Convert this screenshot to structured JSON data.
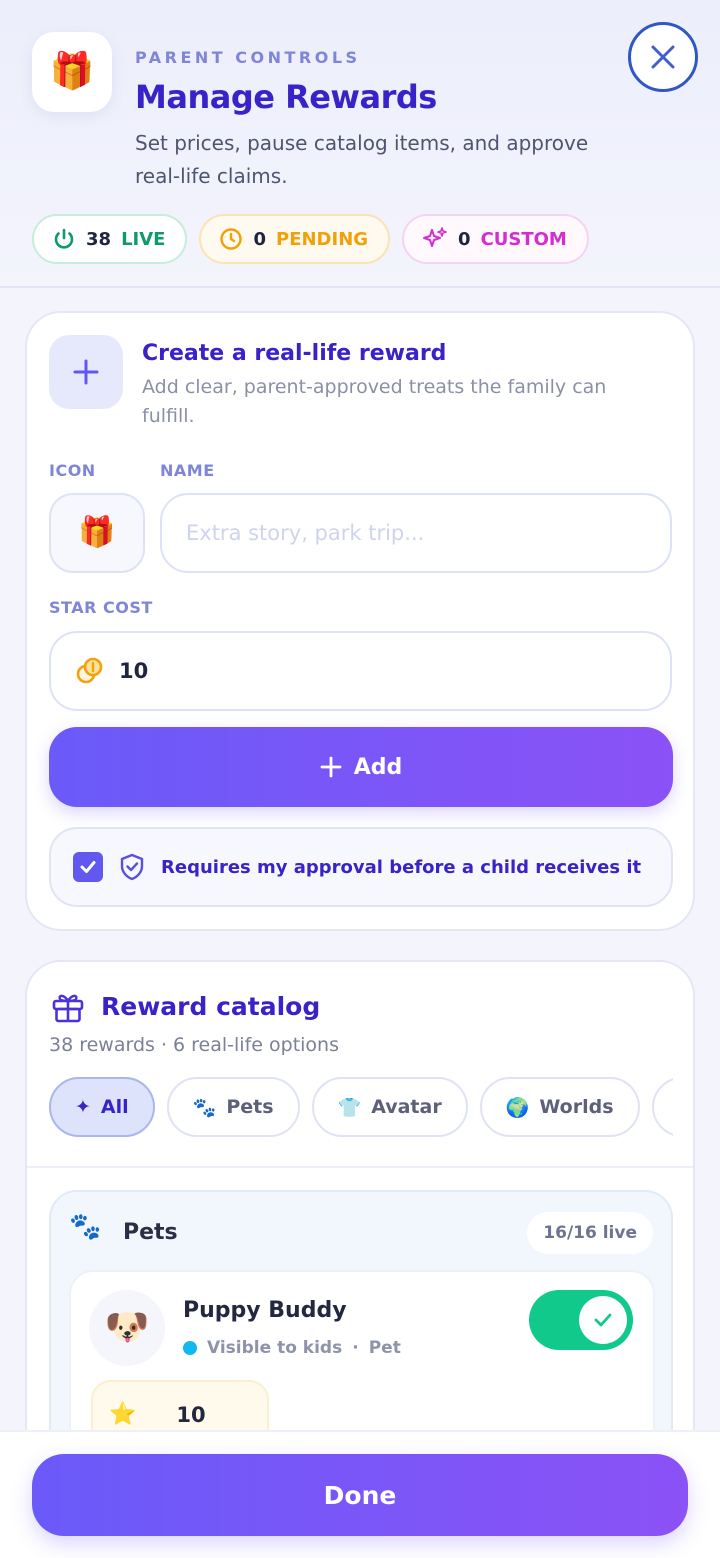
{
  "header": {
    "eyebrow": "PARENT CONTROLS",
    "title": "Manage Rewards",
    "subtitle": "Set prices, pause catalog items, and approve real-life claims.",
    "app_icon": "🎁",
    "close_icon": "close-icon"
  },
  "stats": {
    "live": {
      "count": "38",
      "label": "LIVE",
      "color": "#0f9a6a"
    },
    "pending": {
      "count": "0",
      "label": "PENDING",
      "color": "#f0a10a"
    },
    "custom": {
      "count": "0",
      "label": "CUSTOM",
      "color": "#d22ed0"
    }
  },
  "create": {
    "title": "Create a real-life reward",
    "subtitle": "Add clear, parent-approved treats the family can fulfill.",
    "icon_label": "ICON",
    "name_label": "NAME",
    "icon_value": "🎁",
    "name_value": "",
    "name_placeholder": "Extra story, park trip...",
    "star_cost_label": "STAR COST",
    "star_cost_value": "10",
    "add_label": "Add",
    "approval_label": "Requires my approval before a child receives it",
    "approval_checked": true
  },
  "catalog": {
    "title": "Reward catalog",
    "subtitle": "38 rewards · 6 real-life options",
    "chips": [
      {
        "icon": "✦",
        "label": "All",
        "active": true
      },
      {
        "icon": "🐾",
        "label": "Pets",
        "active": false
      },
      {
        "icon": "👕",
        "label": "Avatar",
        "active": false
      },
      {
        "icon": "🌍",
        "label": "Worlds",
        "active": false
      },
      {
        "icon": "✨",
        "label": "",
        "active": false
      }
    ],
    "group": {
      "icon": "🐾",
      "title": "Pets",
      "badge": "16/16 live",
      "items": [
        {
          "avatar": "🐶",
          "name": "Puppy Buddy",
          "visibility": "Visible to kids",
          "separator": "·",
          "category": "Pet",
          "price_icon": "⭐",
          "price": "10",
          "enabled": true
        }
      ]
    }
  },
  "footer": {
    "done_label": "Done"
  },
  "colors": {
    "accent": "#3a22c9",
    "button_gradient_start": "#6a5af9",
    "button_gradient_end": "#8b52f6",
    "toggle_on": "#12c98c"
  }
}
